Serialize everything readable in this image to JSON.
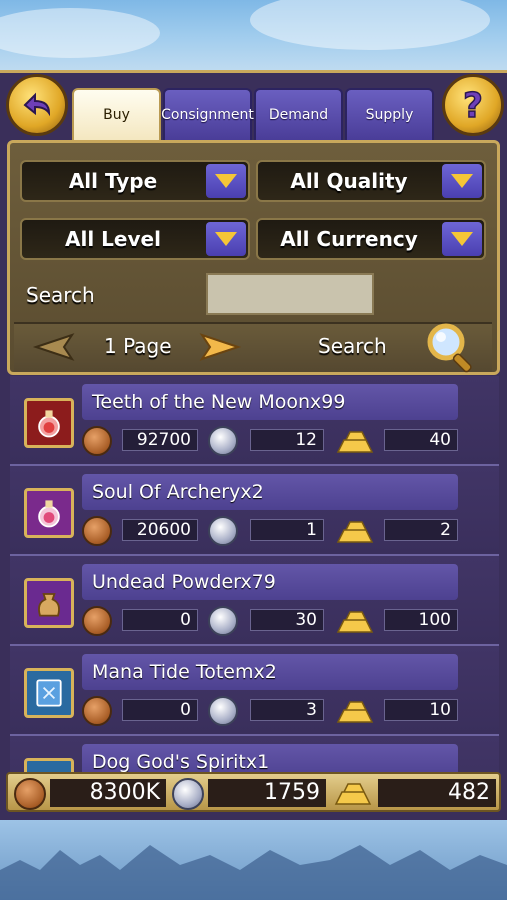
{
  "tabs": [
    {
      "label": "Buy",
      "active": true
    },
    {
      "label": "Consignment",
      "active": false
    },
    {
      "label": "Demand",
      "active": false
    },
    {
      "label": "Supply",
      "active": false
    }
  ],
  "filters": {
    "type": "All Type",
    "quality": "All Quality",
    "level": "All Level",
    "currency": "All Currency"
  },
  "search": {
    "label": "Search",
    "value": ""
  },
  "pager": {
    "page_label": "1 Page",
    "search_button": "Search"
  },
  "items": [
    {
      "name": "Teeth of the New Moonx99",
      "copper": "92700",
      "silver": "12",
      "gold": "40",
      "icon": "red-potion-icon"
    },
    {
      "name": "Soul Of Archeryx2",
      "copper": "20600",
      "silver": "1",
      "gold": "2",
      "icon": "pink-potion-icon"
    },
    {
      "name": "Undead Powderx79",
      "copper": "0",
      "silver": "30",
      "gold": "100",
      "icon": "powder-bag-icon"
    },
    {
      "name": "Mana Tide Totemx2",
      "copper": "0",
      "silver": "3",
      "gold": "10",
      "icon": "spell-book-icon"
    },
    {
      "name": "Dog God's Spiritx1",
      "copper": "",
      "silver": "",
      "gold": "",
      "icon": "blue-item-icon"
    }
  ],
  "wallet": {
    "copper": "8300K",
    "silver": "1759",
    "gold": "482"
  },
  "colors": {
    "accent_gold": "#c9a85c",
    "panel": "#3a2f5a",
    "tab_active": "#f4e7c0"
  }
}
